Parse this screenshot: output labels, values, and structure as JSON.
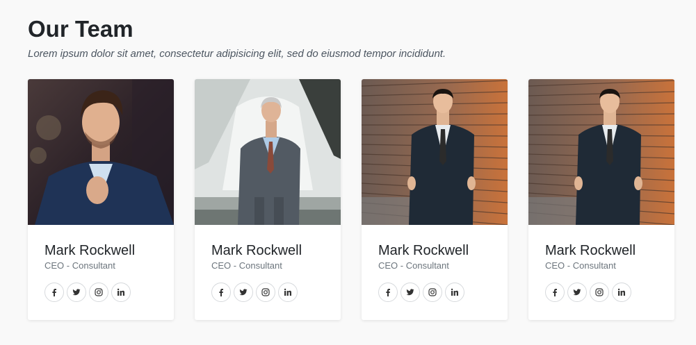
{
  "header": {
    "title": "Our Team",
    "subtitle": "Lorem ipsum dolor sit amet, consectetur adipisicing elit, sed do eiusmod tempor incididunt."
  },
  "members": [
    {
      "name": "Mark Rockwell",
      "role": "CEO - Consultant",
      "photo": "man-in-navy-suit-adjusting-tie"
    },
    {
      "name": "Mark Rockwell",
      "role": "CEO - Consultant",
      "photo": "older-man-in-gray-suit"
    },
    {
      "name": "Mark Rockwell",
      "role": "CEO - Consultant",
      "photo": "man-in-dark-suit-by-wood-wall"
    },
    {
      "name": "Mark Rockwell",
      "role": "CEO - Consultant",
      "photo": "man-in-dark-suit-by-wood-wall"
    }
  ],
  "social_icons": [
    "facebook-icon",
    "twitter-icon",
    "instagram-icon",
    "linkedin-icon"
  ],
  "colors": {
    "page_bg": "#f9f9f9",
    "card_bg": "#ffffff",
    "text": "#212529",
    "muted": "#6c757d"
  }
}
